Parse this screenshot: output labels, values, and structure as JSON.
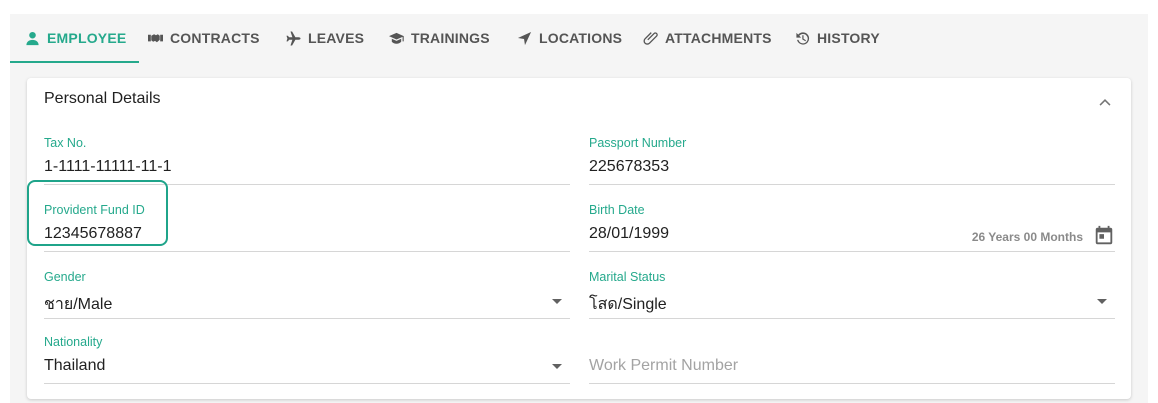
{
  "tabs": [
    {
      "label": "EMPLOYEE",
      "icon": "person-icon",
      "active": true
    },
    {
      "label": "CONTRACTS",
      "icon": "handshake-icon",
      "active": false
    },
    {
      "label": "LEAVES",
      "icon": "airplane-icon",
      "active": false
    },
    {
      "label": "TRAININGS",
      "icon": "graduation-cap-icon",
      "active": false
    },
    {
      "label": "LOCATIONS",
      "icon": "location-arrow-icon",
      "active": false
    },
    {
      "label": "ATTACHMENTS",
      "icon": "paperclip-icon",
      "active": false
    },
    {
      "label": "HISTORY",
      "icon": "history-icon",
      "active": false
    }
  ],
  "section": {
    "title": "Personal Details"
  },
  "fields": {
    "tax_no": {
      "label": "Tax No.",
      "value": "1-1111-11111-11-1"
    },
    "passport": {
      "label": "Passport Number",
      "value": "225678353"
    },
    "provident": {
      "label": "Provident Fund ID",
      "value": "12345678887"
    },
    "birth_date": {
      "label": "Birth Date",
      "value": "28/01/1999",
      "age": "26 Years 00 Months"
    },
    "gender": {
      "label": "Gender",
      "value": "ชาย/Male"
    },
    "marital": {
      "label": "Marital Status",
      "value": "โสด/Single"
    },
    "nationality": {
      "label": "Nationality",
      "value": "Thailand"
    },
    "work_permit": {
      "placeholder": "Work Permit Number"
    }
  },
  "colors": {
    "accent": "#25a98c",
    "highlight": "#1fa48a"
  }
}
